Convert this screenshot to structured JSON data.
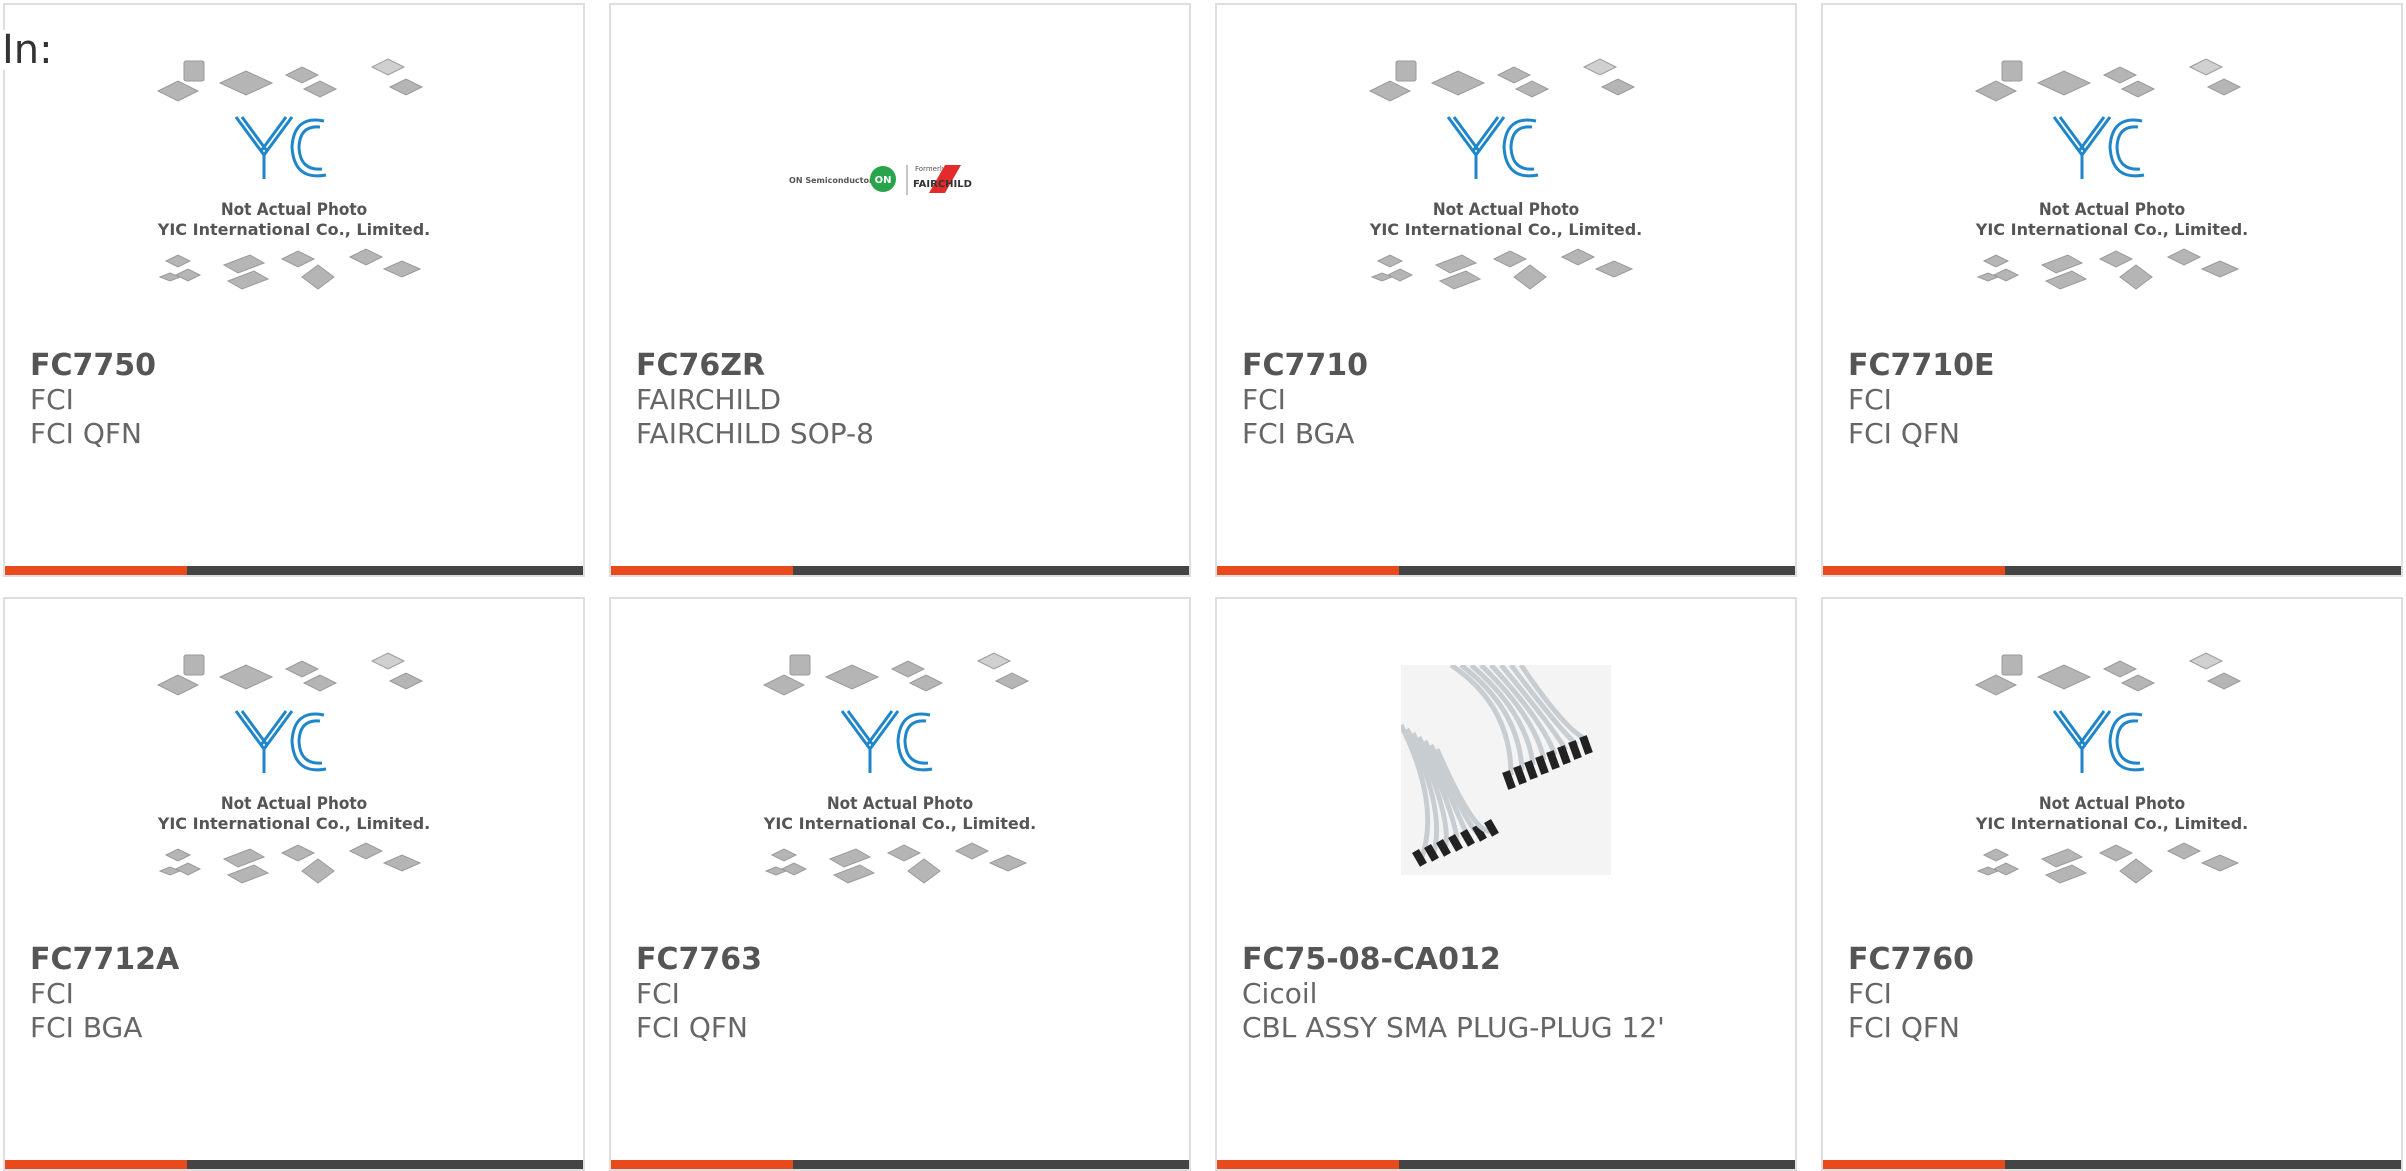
{
  "page_label": "In:",
  "placeholder_text": {
    "line1": "Not Actual Photo",
    "line2": "YIC International Co., Limited.",
    "logo": "YIC"
  },
  "fairchild_logo": {
    "left": "ON Semiconductor",
    "badge": "ON",
    "small": "Formerly",
    "right": "FAIRCHILD"
  },
  "colors": {
    "accent": "#e84a1c",
    "bar": "#444444",
    "yic_blue": "#1f86c9"
  },
  "products": [
    {
      "part": "FC7750",
      "manufacturer": "FCI",
      "description": "FCI QFN",
      "image": "yic-placeholder"
    },
    {
      "part": "FC76ZR",
      "manufacturer": "FAIRCHILD",
      "description": "FAIRCHILD SOP-8",
      "image": "fairchild-logo"
    },
    {
      "part": "FC7710",
      "manufacturer": "FCI",
      "description": "FCI BGA",
      "image": "yic-placeholder"
    },
    {
      "part": "FC7710E",
      "manufacturer": "FCI",
      "description": "FCI QFN",
      "image": "yic-placeholder"
    },
    {
      "part": "FC7712A",
      "manufacturer": "FCI",
      "description": "FCI BGA",
      "image": "yic-placeholder"
    },
    {
      "part": "FC7763",
      "manufacturer": "FCI",
      "description": "FCI QFN",
      "image": "yic-placeholder"
    },
    {
      "part": "FC75-08-CA012",
      "manufacturer": "Cicoil",
      "description": "CBL ASSY SMA PLUG-PLUG 12'",
      "image": "cable-photo"
    },
    {
      "part": "FC7760",
      "manufacturer": "FCI",
      "description": "FCI QFN",
      "image": "yic-placeholder"
    }
  ]
}
